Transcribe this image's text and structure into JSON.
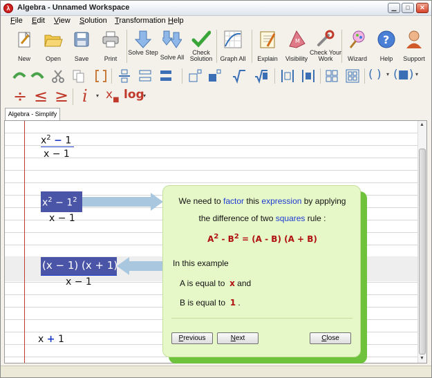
{
  "window": {
    "title": "Algebra - Unnamed Workspace",
    "app_icon": "algebra-app-icon",
    "min_glyph": "▁",
    "max_glyph": "□",
    "close_glyph": "✕"
  },
  "menu": [
    "File",
    "Edit",
    "View",
    "Solution",
    "Transformation",
    "Help"
  ],
  "toolbar": {
    "buttons": [
      {
        "label": "New",
        "icon": "new-document-icon"
      },
      {
        "label": "Open",
        "icon": "open-folder-icon"
      },
      {
        "label": "Save",
        "icon": "save-disk-icon"
      },
      {
        "label": "Print",
        "icon": "printer-icon"
      },
      {
        "label": "Solve Step",
        "icon": "solve-step-arrow-icon"
      },
      {
        "label": "Solve All",
        "icon": "solve-all-arrows-icon"
      },
      {
        "label": "Check Solution",
        "icon": "check-mark-icon"
      },
      {
        "label": "Graph All",
        "icon": "graph-icon"
      },
      {
        "label": "Explain",
        "icon": "explain-notebook-icon"
      },
      {
        "label": "Visibility",
        "icon": "visibility-book-icon"
      },
      {
        "label": "Check Your Work",
        "icon": "check-work-wrench-icon"
      },
      {
        "label": "Wizard",
        "icon": "wizard-wand-icon"
      },
      {
        "label": "Help",
        "icon": "help-question-icon"
      },
      {
        "label": "Support",
        "icon": "support-person-icon"
      }
    ]
  },
  "format_bar": {
    "symbols": [
      "÷",
      "≤",
      "≥",
      "i",
      "x",
      "log"
    ],
    "paren_label": "( )",
    "paren_square_label": "(■)"
  },
  "tab": {
    "label": "Algebra - Simplify"
  },
  "workspace": {
    "expr1": {
      "num": "x",
      "exp": "2",
      "minus": "−",
      "one": "1",
      "den": "x − 1"
    },
    "expr2": {
      "num": "x",
      "exp": "2",
      "minus": "−",
      "one": "1",
      "exp2": "2",
      "den": "x − 1"
    },
    "expr3": {
      "num": "(x − 1)  (x + 1)",
      "den": "x − 1"
    },
    "result": {
      "x": "x",
      "plus": "+",
      "one": "1"
    }
  },
  "explain": {
    "line1_a": "We need to ",
    "line1_link1": "factor",
    "line1_b": " this ",
    "line1_link2": "expression",
    "line1_c": " by applying",
    "line2_a": "the difference of two ",
    "line2_link": "squares",
    "line2_b": " rule :",
    "rule": {
      "a": "A",
      "a_exp": "2",
      "minus": " - B",
      "b_exp": "2",
      "rest": " = (A - B)  (A + B)"
    },
    "example": "In this example",
    "a_is": "A is equal to",
    "a_val": "x",
    "a_and": "and",
    "b_is": "B is equal to",
    "b_val": "1",
    "b_end": ".",
    "buttons": {
      "previous": "Previous",
      "next": "Next",
      "close": "Close"
    }
  }
}
